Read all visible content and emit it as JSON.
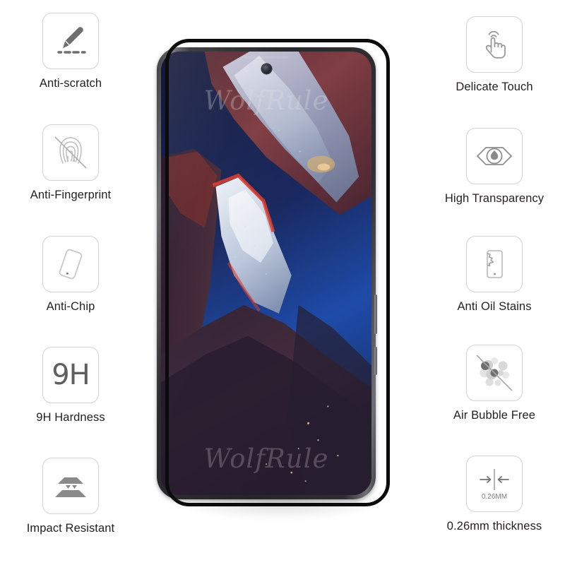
{
  "product": {
    "type": "tempered-glass-screen-protector-infographic",
    "brand_watermark": "WolfRule",
    "background_color": "#ffffff",
    "label_color": "#231f20",
    "icon_border_color": "#d2d2d2",
    "icon_fill_color": "#6f6f6f"
  },
  "features_left": [
    {
      "id": "anti-scratch",
      "label": "Anti-scratch",
      "icon": "stylus-pen-scratch-icon"
    },
    {
      "id": "anti-fingerprint",
      "label": "Anti-Fingerprint",
      "icon": "fingerprint-crossed-icon"
    },
    {
      "id": "anti-chip",
      "label": "Anti-Chip",
      "icon": "tilted-phone-icon"
    },
    {
      "id": "hardness-9h",
      "label": "9H Hardness",
      "icon": "9h-text-icon",
      "icon_text": "9H"
    },
    {
      "id": "impact-resistant",
      "label": "Impact Resistant",
      "icon": "stacked-layers-impact-icon"
    }
  ],
  "features_right": [
    {
      "id": "delicate-touch",
      "label": "Delicate Touch",
      "icon": "tapping-hand-icon"
    },
    {
      "id": "high-transparency",
      "label": "High Transparency",
      "icon": "eye-icon"
    },
    {
      "id": "anti-oil-stains",
      "label": "Anti Oil Stains",
      "icon": "phone-oil-splash-icon"
    },
    {
      "id": "air-bubble-free",
      "label": "Air Bubble Free",
      "icon": "bubbles-crossed-icon"
    },
    {
      "id": "thickness",
      "label": "0.26mm thickness",
      "icon": "thickness-arrows-icon",
      "icon_text": "0.26MM"
    }
  ],
  "phone": {
    "frame_color": "#2b2b2e",
    "glass_border_color": "#0b0b0c",
    "screen_wallpaper": "dark-blue-red-abstract-landscape",
    "camera": "punch-hole-front-camera",
    "buttons": [
      "power-button",
      "volume-button"
    ]
  }
}
